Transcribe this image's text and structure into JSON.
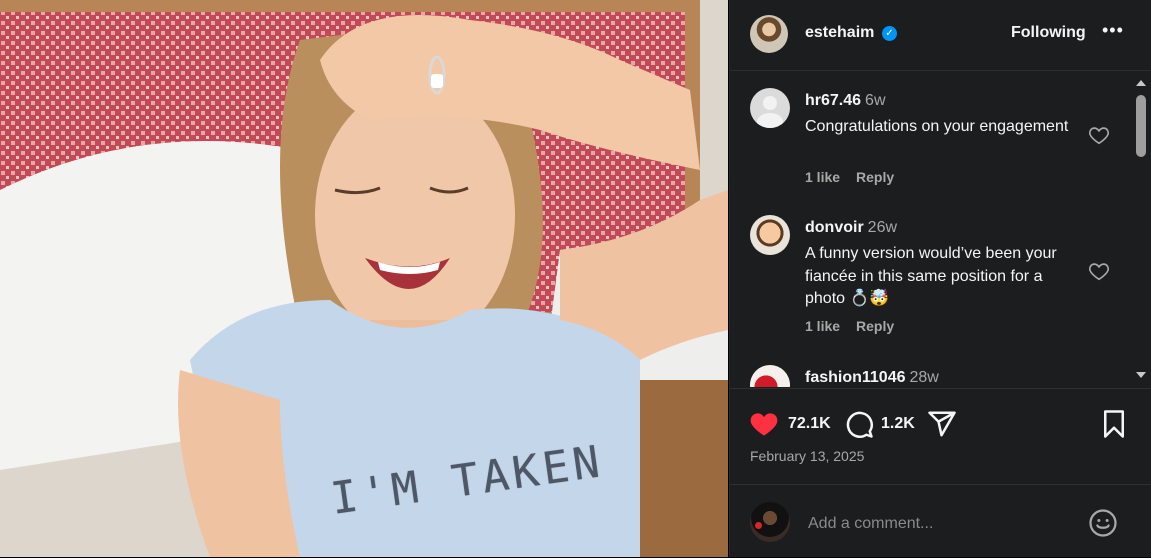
{
  "photo": {
    "shirt_text": "I'M TAKEN"
  },
  "header": {
    "username": "estehaim",
    "verified": true,
    "follow_label": "Following",
    "more_label": "•••"
  },
  "comments": [
    {
      "username": "hr67.46",
      "time": "6w",
      "text": "Congratulations on your engagement",
      "likes": "1 like",
      "reply": "Reply",
      "avatar": "default-avatar"
    },
    {
      "username": "donvoir",
      "time": "26w",
      "text": "A funny version would’ve been your fiancée in this same position for a photo 💍🤯",
      "likes": "1 like",
      "reply": "Reply",
      "avatar": "memoji-avatar"
    },
    {
      "username": "fashion11046",
      "time": "28w",
      "text": "",
      "avatar": "fashion-avatar"
    }
  ],
  "actions": {
    "like_count": "72.1K",
    "comment_count": "1.2K",
    "date": "February 13, 2025"
  },
  "comment_box": {
    "placeholder": "Add a comment..."
  },
  "colors": {
    "panel_bg": "#1c1d1f",
    "like_red": "#ff3040",
    "verified_blue": "#0095f6",
    "muted_text": "#a8a8a8"
  }
}
